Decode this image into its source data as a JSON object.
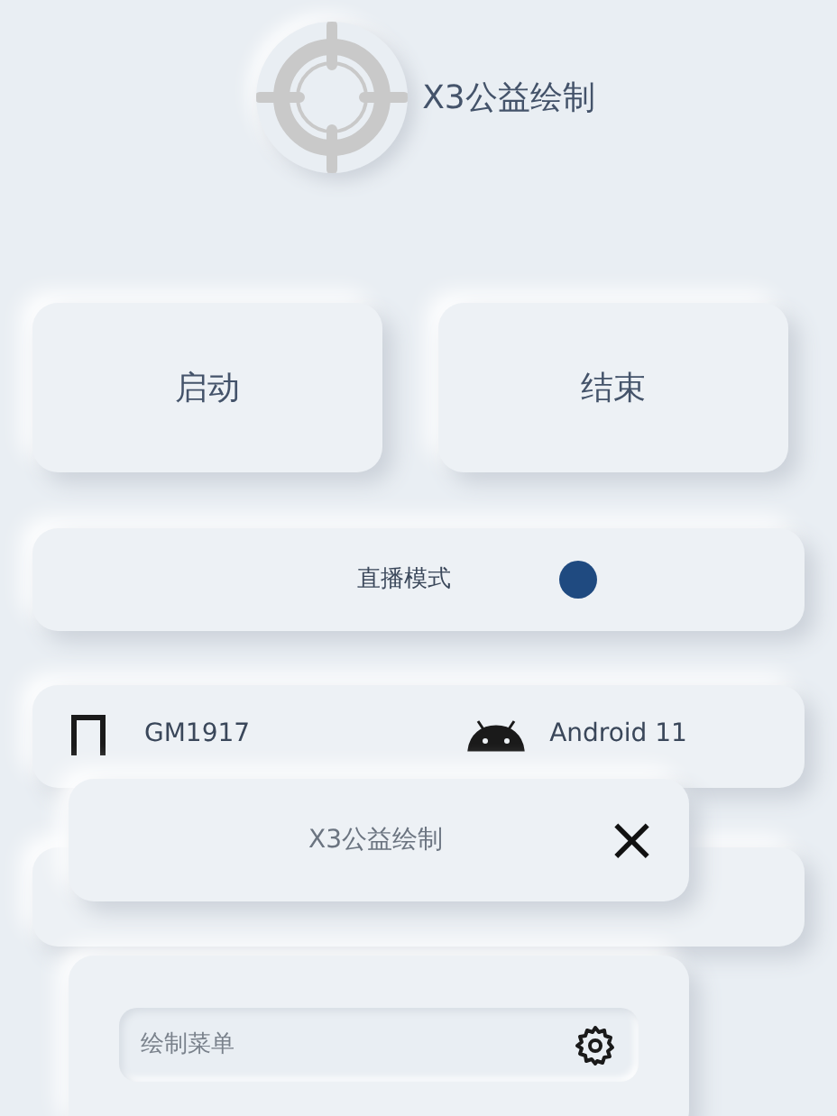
{
  "header": {
    "title": "X3公益绘制"
  },
  "buttons": [
    {
      "label": "启动"
    },
    {
      "label": "结束"
    }
  ],
  "live_mode": {
    "label": "直播模式",
    "on": true
  },
  "device": {
    "model": "GM1917",
    "os": "Android 11"
  },
  "floating_window": {
    "title": "X3公益绘制",
    "close": "×",
    "menu_item": {
      "label": "绘制菜单"
    }
  }
}
